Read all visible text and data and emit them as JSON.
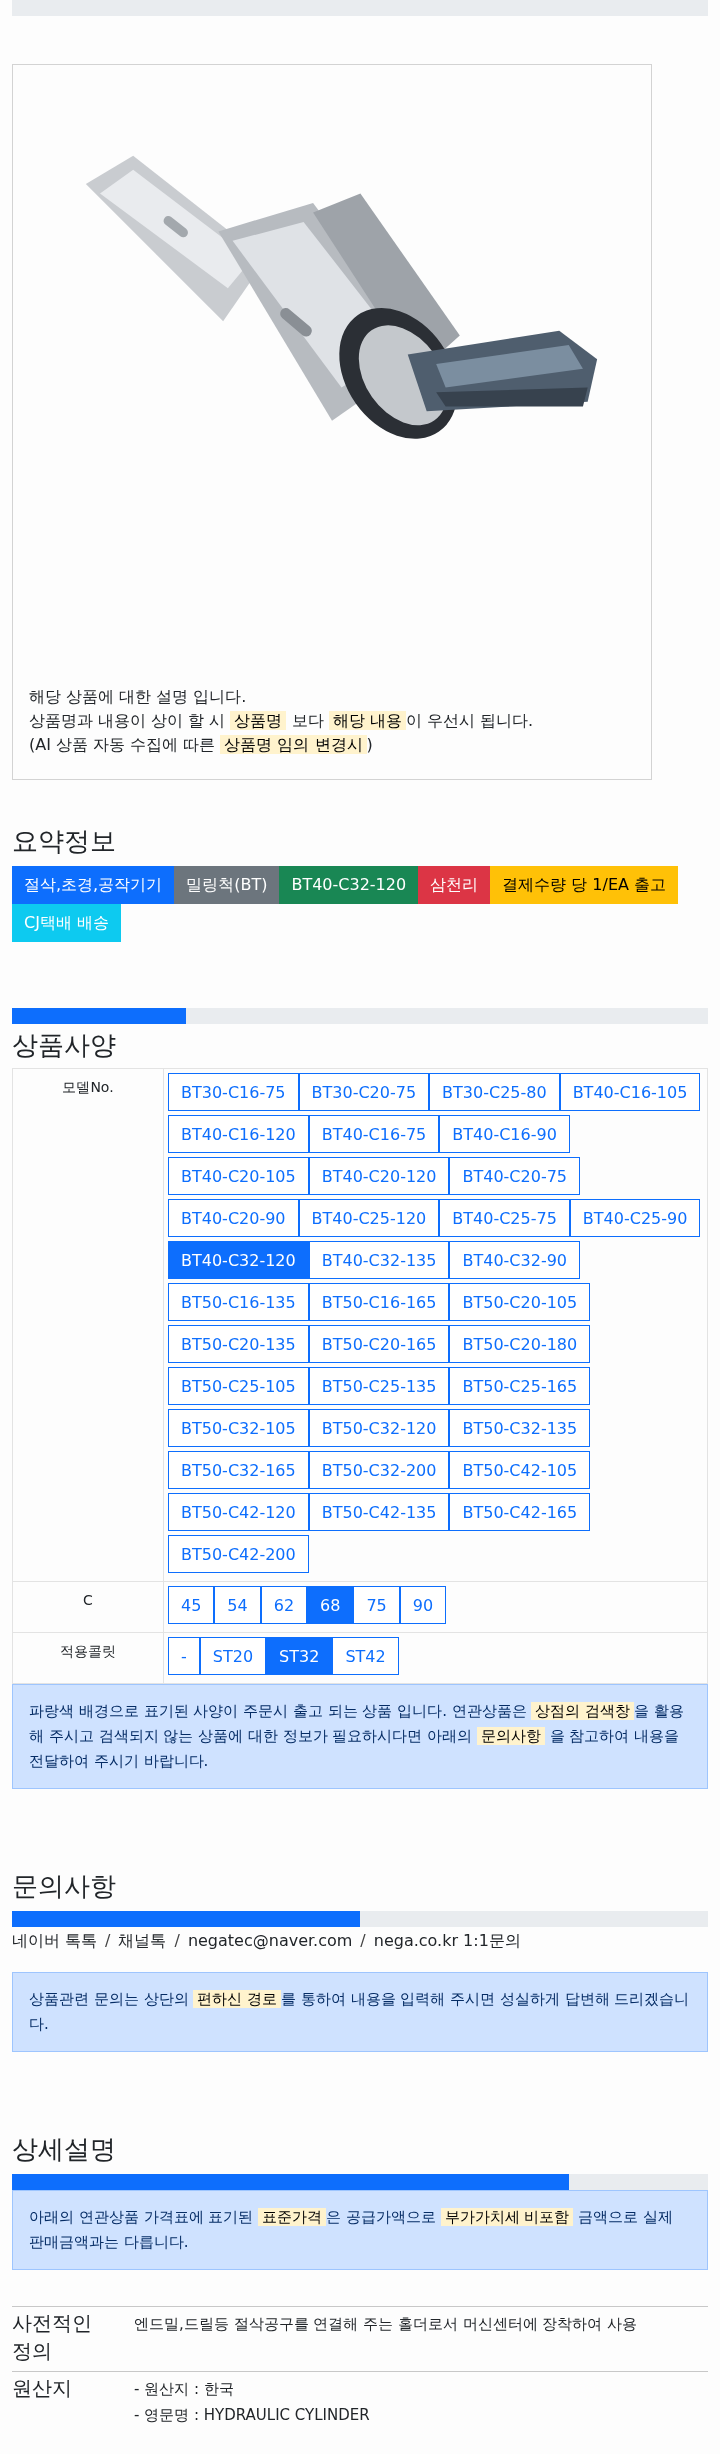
{
  "product_card": {
    "image": {
      "kind": "picture"
    },
    "lines": [
      "해당 상품에 대한 설명 입니다.",
      "상품명과 내용이 상이 할 시 **상품명** 보다 **해당 내용**이 우선시 됩니다.",
      "(AI 상품 자동 수집에 따른 **상품명 임의 변경시**)"
    ]
  },
  "summary": {
    "title": "요약정보",
    "tags": [
      {
        "label": "절삭,초경,공작기기",
        "color": "#0d6efd"
      },
      {
        "label": "밀링척(BT)",
        "color": "#6c757d"
      },
      {
        "label": "BT40-C32-120",
        "color": "#198754"
      },
      {
        "label": "삼천리",
        "color": "#dc3545"
      },
      {
        "label": "결제수량 당 1/EA 출고",
        "color": "#ffc107"
      },
      {
        "label": "CJ택배 배송",
        "color": "#0dcaf0"
      }
    ]
  },
  "specs": {
    "progress": {
      "level": 0.25
    },
    "title": "상품사양",
    "rows": [
      {
        "label": "모델No.",
        "options": [
          {
            "label": "BT30-C16-75",
            "selected": false
          },
          {
            "label": "BT30-C20-75",
            "selected": false
          },
          {
            "label": "BT30-C25-80",
            "selected": false
          },
          {
            "label": "BT40-C16-105",
            "selected": false
          },
          {
            "label": "BT40-C16-120",
            "selected": false
          },
          {
            "label": "BT40-C16-75",
            "selected": false
          },
          {
            "label": "BT40-C16-90",
            "selected": false
          },
          {
            "label": "BT40-C20-105",
            "selected": false
          },
          {
            "label": "BT40-C20-120",
            "selected": false
          },
          {
            "label": "BT40-C20-75",
            "selected": false
          },
          {
            "label": "BT40-C20-90",
            "selected": false
          },
          {
            "label": "BT40-C25-120",
            "selected": false
          },
          {
            "label": "BT40-C25-75",
            "selected": false
          },
          {
            "label": "BT40-C25-90",
            "selected": false
          },
          {
            "label": "BT40-C32-120",
            "selected": true
          },
          {
            "label": "BT40-C32-135",
            "selected": false
          },
          {
            "label": "BT40-C32-90",
            "selected": false
          },
          {
            "label": "BT50-C16-135",
            "selected": false
          },
          {
            "label": "BT50-C16-165",
            "selected": false
          },
          {
            "label": "BT50-C20-105",
            "selected": false
          },
          {
            "label": "BT50-C20-135",
            "selected": false
          },
          {
            "label": "BT50-C20-165",
            "selected": false
          },
          {
            "label": "BT50-C20-180",
            "selected": false
          },
          {
            "label": "BT50-C25-105",
            "selected": false
          },
          {
            "label": "BT50-C25-135",
            "selected": false
          },
          {
            "label": "BT50-C25-165",
            "selected": false
          },
          {
            "label": "BT50-C32-105",
            "selected": false
          },
          {
            "label": "BT50-C32-120",
            "selected": false
          },
          {
            "label": "BT50-C32-135",
            "selected": false
          },
          {
            "label": "BT50-C32-165",
            "selected": false
          },
          {
            "label": "BT50-C32-200",
            "selected": false
          },
          {
            "label": "BT50-C42-105",
            "selected": false
          },
          {
            "label": "BT50-C42-120",
            "selected": false
          },
          {
            "label": "BT50-C42-135",
            "selected": false
          },
          {
            "label": "BT50-C42-165",
            "selected": false
          },
          {
            "label": "BT50-C42-200",
            "selected": false
          }
        ]
      },
      {
        "label": "C",
        "options": [
          {
            "label": "45",
            "selected": false
          },
          {
            "label": "54",
            "selected": false
          },
          {
            "label": "62",
            "selected": false
          },
          {
            "label": "68",
            "selected": true
          },
          {
            "label": "75",
            "selected": false
          },
          {
            "label": "90",
            "selected": false
          }
        ]
      },
      {
        "label": "적용콜릿",
        "options": [
          {
            "label": "-",
            "selected": false
          },
          {
            "label": "ST20",
            "selected": false
          },
          {
            "label": "ST32",
            "selected": true
          },
          {
            "label": "ST42",
            "selected": false
          }
        ]
      }
    ],
    "notice": "파랑색 배경으로 표기된 사양이 주문시 출고 되는 상품 입니다. 연관상품은 **상점의 검색창**을 활용해 주시고 검색되지 않는 상품에 대한 정보가 필요하시다면 아래의 **문의사항** 을 참고하여 내용을 전달하여 주시기 바랍니다."
  },
  "inquiry": {
    "title": "문의사항",
    "progress": {
      "level": 0.5
    },
    "channels": [
      "네이버 톡톡",
      "채널톡",
      "negatec@naver.com",
      "nega.co.kr 1:1문의"
    ],
    "separator": "/",
    "notice": "상품관련 문의는 상단의 **편하신 경로**를 통하여 내용을 입력해 주시면 성실하게 답변해 드리겠습니다."
  },
  "details": {
    "title": "상세설명",
    "progress": {
      "level": 0.8
    },
    "notice": "아래의 연관상품 가격표에 표기된 **표준가격**은 공급가액으로 **부가가치세 비포함** 금액으로 실제 판매금액과는 다릅니다.",
    "rows": [
      {
        "label": "사전적인 정의",
        "lines": [
          "엔드밀,드릴등 절삭공구를 연결해 주는 홀더로서 머신센터에 장착하여 사용"
        ]
      },
      {
        "label": "원산지",
        "lines": [
          "- 원산지 : 한국",
          "- 영문명 : HYDRAULIC CYLINDER"
        ]
      }
    ]
  }
}
